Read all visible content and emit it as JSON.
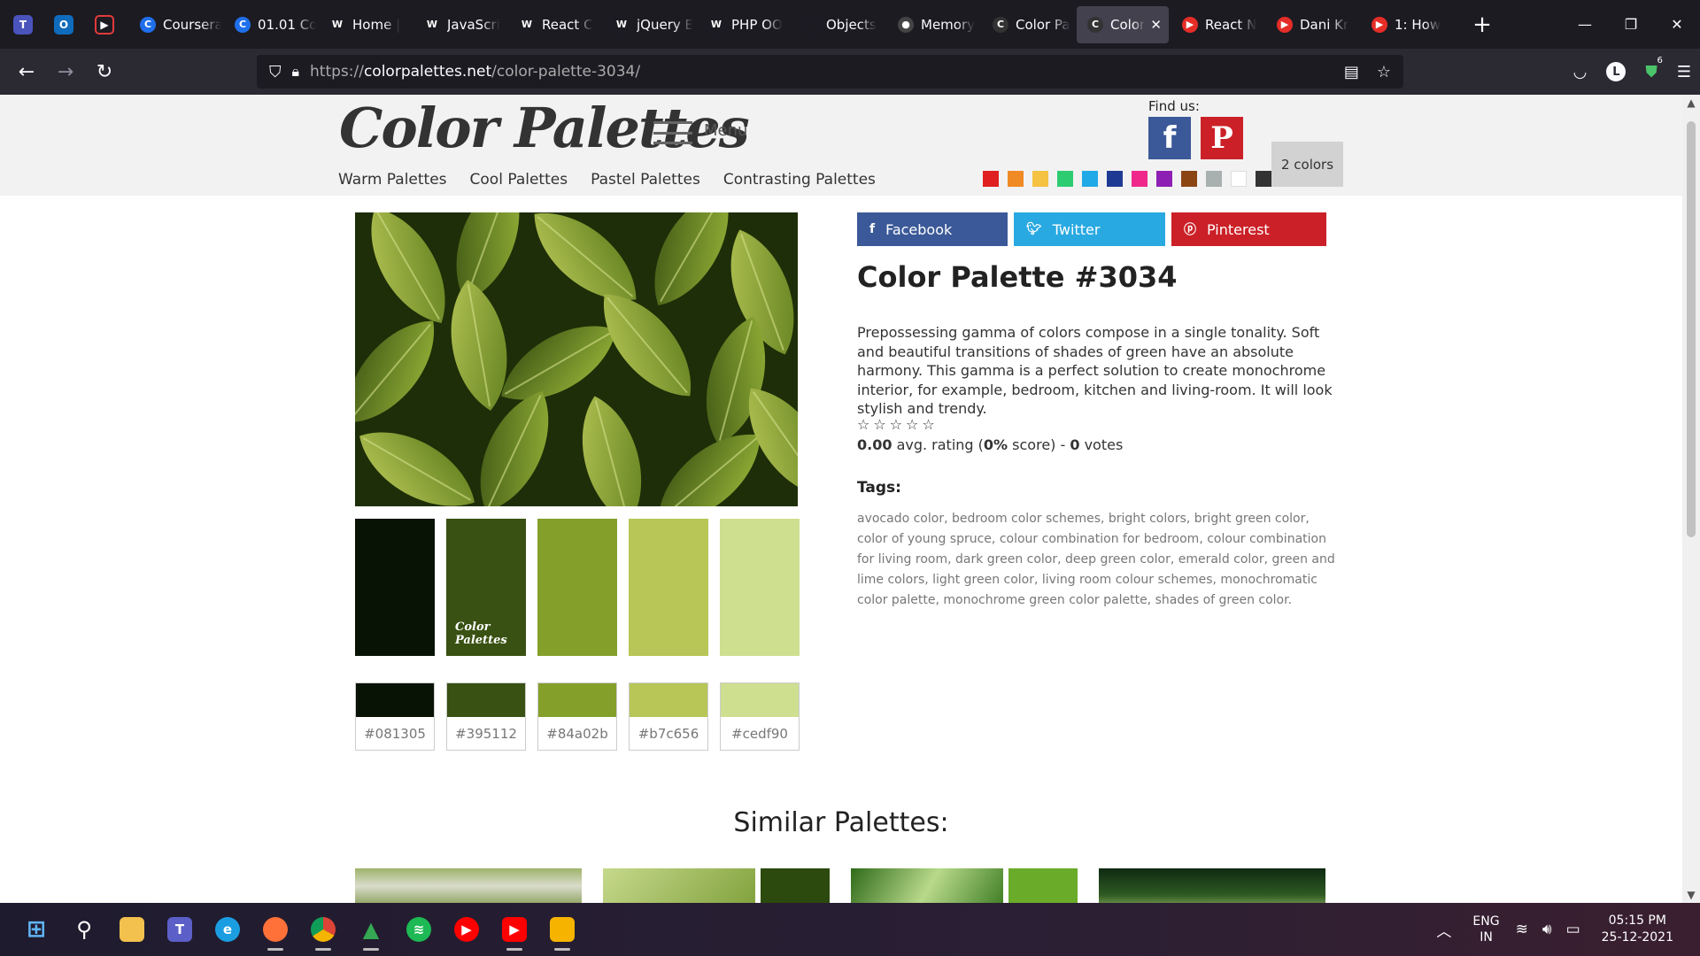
{
  "browser": {
    "tabs": [
      {
        "label": "Coursera",
        "fav_color": "#1f6feb",
        "fav_glyph": "C"
      },
      {
        "label": "01.01 Co",
        "fav_color": "#1f6feb",
        "fav_glyph": "C"
      },
      {
        "label": "Home |",
        "fav_color": "#1c1b22",
        "fav_glyph": "W"
      },
      {
        "label": "JavaScri",
        "fav_color": "#1c1b22",
        "fav_glyph": "W"
      },
      {
        "label": "React C",
        "fav_color": "#1c1b22",
        "fav_glyph": "W"
      },
      {
        "label": "jQuery E",
        "fav_color": "#1c1b22",
        "fav_glyph": "W"
      },
      {
        "label": "PHP OO",
        "fav_color": "#1c1b22",
        "fav_glyph": "W"
      },
      {
        "label": "Objects",
        "fav_color": "#1c1b22",
        "fav_glyph": ""
      },
      {
        "label": "Memory",
        "fav_color": "#444",
        "fav_glyph": "●"
      },
      {
        "label": "Color Pa",
        "fav_color": "#333",
        "fav_glyph": "C"
      },
      {
        "label": "Color",
        "fav_color": "#333",
        "fav_glyph": "C",
        "active": true
      },
      {
        "label": "React N",
        "fav_color": "#e52d27",
        "fav_glyph": "▶"
      },
      {
        "label": "Dani Kr",
        "fav_color": "#e52d27",
        "fav_glyph": "▶"
      },
      {
        "label": "1: How",
        "fav_color": "#e52d27",
        "fav_glyph": "▶"
      }
    ],
    "url_prefix": "https://",
    "url_host": "colorpalettes.net",
    "url_path": "/color-palette-3034/",
    "extension_badge": "6",
    "avatar_letter": "L"
  },
  "site": {
    "logo": "Color Palettes",
    "menu_label": "Menu",
    "nav": [
      "Warm Palettes",
      "Cool Palettes",
      "Pastel Palettes",
      "Contrasting Palettes"
    ],
    "find_us": "Find us:",
    "colors_button": "2 colors",
    "filter_swatches": [
      "#e02020",
      "#f08a24",
      "#f5c242",
      "#2ecc71",
      "#1fa9e6",
      "#1f3a93",
      "#f0288c",
      "#8e1fb4",
      "#8b4513",
      "#a8b0b0",
      "#ffffff",
      "#333333"
    ]
  },
  "palette": {
    "share": {
      "facebook": "Facebook",
      "twitter": "Twitter",
      "pinterest": "Pinterest"
    },
    "title": "Color Palette #3034",
    "description": "Prepossessing gamma of colors compose in a single tonality. Soft and beautiful transitions of shades of green have an absolute harmony. This gamma is a perfect solution to create monochrome interior, for example, bedroom, kitchen and living-room. It will look stylish and trendy.",
    "stars": "☆☆☆☆☆",
    "rating_value": "0.00",
    "rating_avg_text": " avg. rating (",
    "rating_score": "0%",
    "rating_score_text": " score) - ",
    "rating_votes": "0",
    "rating_votes_text": " votes",
    "watermark_line1": "Color",
    "watermark_line2": "Palettes",
    "colors": [
      "#081305",
      "#395112",
      "#84a02b",
      "#b7c656",
      "#cedf90"
    ],
    "tags_heading": "Tags:",
    "tags": "avocado color, bedroom color schemes, bright colors, bright green color, color of young spruce, colour combination for bedroom, colour combination for living room, dark green color, deep green color, emerald color, green and lime colors, light green color, living room colour schemes, monochromatic color palette, monochrome green color palette, shades of green color."
  },
  "similar": {
    "heading": "Similar Palettes:"
  },
  "taskbar": {
    "lang_1": "ENG",
    "lang_2": "IN",
    "time": "05:15 PM",
    "date": "25-12-2021"
  }
}
